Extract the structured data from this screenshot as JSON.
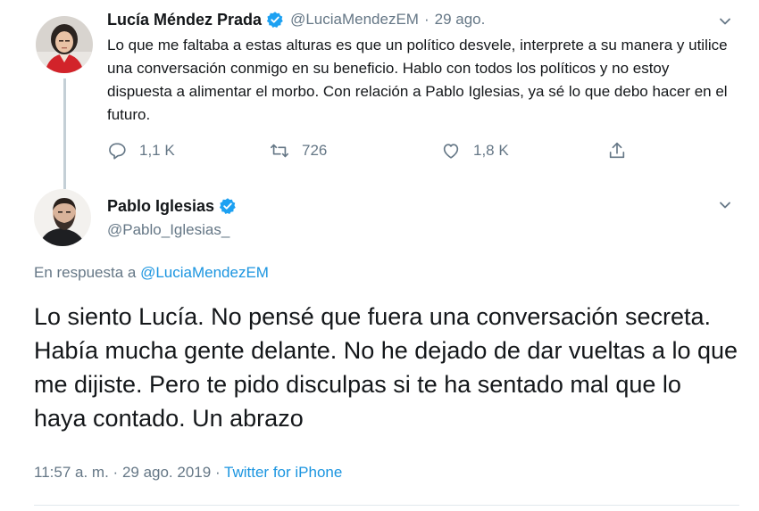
{
  "tweet1": {
    "display_name": "Lucía Méndez Prada",
    "handle": "@LuciaMendezEM",
    "separator": "·",
    "date": "29 ago.",
    "text": "Lo que me faltaba a estas alturas es que un político desvele, interprete a su manera y utilice una conversación conmigo en su beneficio. Hablo con todos los políticos y no estoy dispuesta a alimentar el morbo. Con relación a Pablo Iglesias, ya sé lo que debo hacer en el futuro.",
    "replies": "1,1 K",
    "retweets": "726",
    "likes": "1,8 K",
    "icons": [
      "reply-icon",
      "retweet-icon",
      "like-icon",
      "share-icon",
      "verified-badge-icon",
      "chevron-down-icon"
    ]
  },
  "tweet2": {
    "display_name": "Pablo Iglesias",
    "handle": "@Pablo_Iglesias_",
    "reply_to_prefix": "En respuesta a",
    "reply_to_handle": "@LuciaMendezEM",
    "text": "Lo siento Lucía. No pensé que fuera una conversación secreta. Había mucha gente delante. No he dejado de dar vueltas a lo que me dijiste. Pero te pido disculpas si te ha sentado mal que lo haya contado. Un abrazo",
    "time": "11:57 a. m.",
    "separator": "·",
    "date": "29 ago. 2019",
    "source": "Twitter for iPhone"
  },
  "colors": {
    "text": "#14171a",
    "secondary": "#657786",
    "link": "#1b95e0",
    "verified": "#1da1f2",
    "thread_line": "#c4cfd6"
  }
}
